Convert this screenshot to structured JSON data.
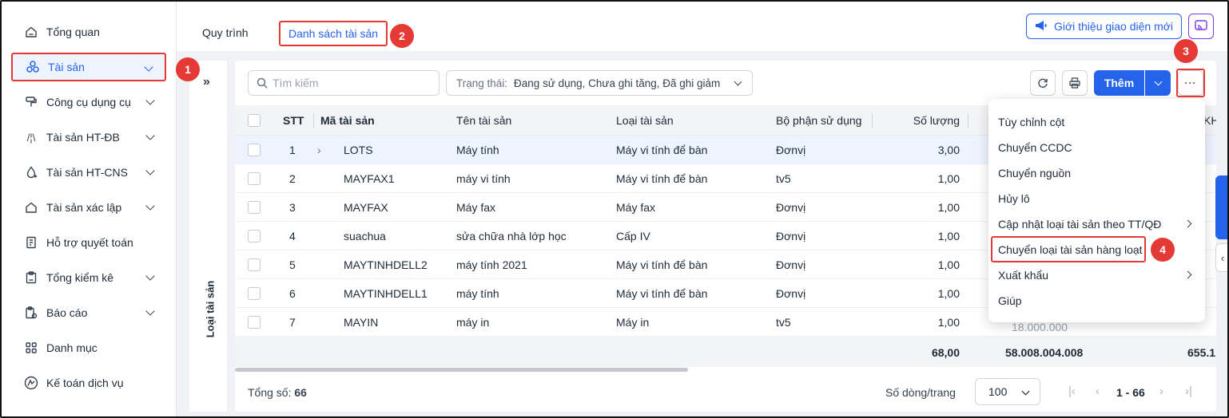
{
  "sidebar": {
    "items": [
      {
        "label": "Tổng quan",
        "icon": "home-icon",
        "expandable": false
      },
      {
        "label": "Tài sản",
        "icon": "assets-icon",
        "expandable": true,
        "active": true
      },
      {
        "label": "Công cụ dụng cụ",
        "icon": "tools-icon",
        "expandable": true
      },
      {
        "label": "Tài sản HT-ĐB",
        "icon": "road-icon",
        "expandable": true
      },
      {
        "label": "Tài sản HT-CNS",
        "icon": "water-drop-icon",
        "expandable": true
      },
      {
        "label": "Tài sản xác lập",
        "icon": "house-icon",
        "expandable": true
      },
      {
        "label": "Hỗ trợ quyết toán",
        "icon": "ledger-icon",
        "expandable": false
      },
      {
        "label": "Tổng kiểm kê",
        "icon": "clipboard-icon",
        "expandable": true
      },
      {
        "label": "Báo cáo",
        "icon": "report-icon",
        "expandable": true
      },
      {
        "label": "Danh mục",
        "icon": "grid-icon",
        "expandable": false
      },
      {
        "label": "Kế toán dịch vụ",
        "icon": "service-icon",
        "expandable": false
      }
    ]
  },
  "header": {
    "tabs": [
      "Quy trình",
      "Danh sách tài sản"
    ],
    "active_tab": 1,
    "intro_button": "Giới thiệu giao diện mới"
  },
  "side_panel": {
    "label": "Loại tài sản",
    "expand_glyph": "»"
  },
  "toolbar": {
    "search_placeholder": "Tìm kiếm",
    "filter_label": "Trạng thái:",
    "filter_value": "Đang sử dụng, Chưa ghi tăng, Đã ghi giảm",
    "add_label": "Thêm",
    "more_glyph": "···"
  },
  "table": {
    "headers": [
      "STT",
      "Mã tài sản",
      "Tên tài sản",
      "Loại tài sản",
      "Bộ phận sử dụng",
      "Số lượng",
      "KH"
    ],
    "rows": [
      {
        "stt": "1",
        "code": "LOTS",
        "name": "Máy tính",
        "type": "Máy vi tính để bàn",
        "dept": "Đơnvị",
        "qty": "3,00",
        "expandable": true,
        "selected": true
      },
      {
        "stt": "2",
        "code": "MAYFAX1",
        "name": "máy vi tính",
        "type": "Máy vi tính để bàn",
        "dept": "tv5",
        "qty": "1,00"
      },
      {
        "stt": "3",
        "code": "MAYFAX",
        "name": "Máy fax",
        "type": "Máy fax",
        "dept": "Đơnvị",
        "qty": "1,00"
      },
      {
        "stt": "4",
        "code": "suachua",
        "name": "sửa chữa nhà lớp học",
        "type": "Cấp IV",
        "dept": "Đơnvị",
        "qty": "1,00"
      },
      {
        "stt": "5",
        "code": "MAYTINHDELL2",
        "name": "máy tính 2021",
        "type": "Máy vi tính để bàn",
        "dept": "Đơnvị",
        "qty": "1,00"
      },
      {
        "stt": "6",
        "code": "MAYTINHDELL1",
        "name": "máy tính",
        "type": "Máy vi tính để bàn",
        "dept": "Đơnvị",
        "qty": "1,00"
      },
      {
        "stt": "7",
        "code": "MAYIN",
        "name": "máy in",
        "type": "Máy in",
        "dept": "tv5",
        "qty": "1,00",
        "partial": "18.000.000"
      }
    ],
    "totals": {
      "qty": "68,00",
      "value": "58.008.004.008",
      "kh": "655.1"
    }
  },
  "footer": {
    "total_label": "Tổng số:",
    "total_value": "66",
    "page_size_label": "Số dòng/trang",
    "page_size": "100",
    "range": "1 - 66"
  },
  "more_menu": {
    "items": [
      {
        "label": "Tùy chỉnh cột",
        "submenu": false
      },
      {
        "label": "Chuyển CCDC",
        "submenu": false
      },
      {
        "label": "Chuyển nguồn",
        "submenu": false
      },
      {
        "label": "Hủy lô",
        "submenu": false
      },
      {
        "label": "Cập nhật loại tài sản theo TT/QĐ",
        "submenu": true
      },
      {
        "label": "Chuyển loại tài sản hàng loạt",
        "submenu": false,
        "highlighted": true
      },
      {
        "label": "Xuất khẩu",
        "submenu": true
      },
      {
        "label": "Giúp",
        "submenu": false
      }
    ]
  },
  "annotations": [
    "1",
    "2",
    "3",
    "4"
  ],
  "colors": {
    "primary": "#2563eb",
    "highlight": "#e53935",
    "selected_row": "#eef4ff",
    "background": "#f0f2f5"
  }
}
